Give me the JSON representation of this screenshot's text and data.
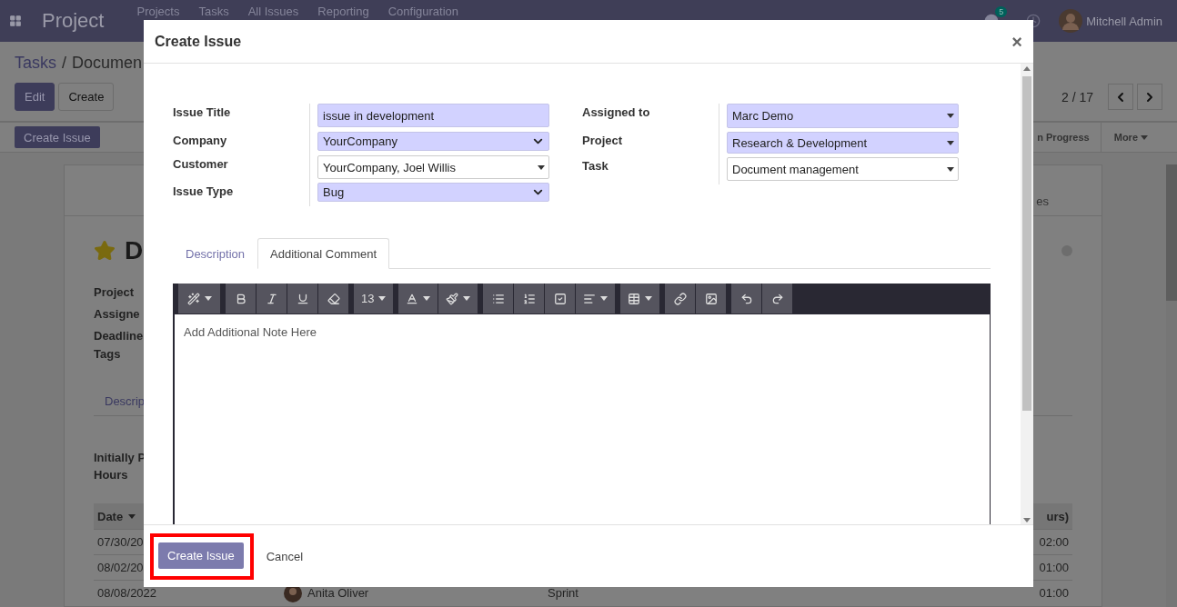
{
  "app_bar": {
    "app_name": "Project",
    "menu": [
      "Projects",
      "Tasks",
      "All Issues",
      "Reporting",
      "Configuration"
    ],
    "chat_badge": "5",
    "user_name": "Mitchell Admin"
  },
  "breadcrumb": {
    "parent": "Tasks",
    "separator": "/",
    "current": "Documen"
  },
  "control_buttons": [
    {
      "label": "Edit",
      "kind": "primary"
    },
    {
      "label": "Create",
      "kind": "secondary"
    }
  ],
  "pager": "2 / 17",
  "status_bar": {
    "button": "Create Issue",
    "stage": "n Progress",
    "more": "More"
  },
  "record": {
    "tab": "es",
    "starred": true,
    "title": "D",
    "field_labels": [
      "Project",
      "Assigne",
      "Deadline",
      "Tags"
    ],
    "notebook_tab": "Descrip",
    "hours_labels": [
      "Initially P",
      "Hours"
    ],
    "table": {
      "columns": [
        "Date",
        "urs)"
      ],
      "rows": [
        {
          "date": "07/30/20",
          "hours": "02:00"
        },
        {
          "date": "08/02/20",
          "hours": "01:00"
        },
        {
          "date": "08/08/2022",
          "employee": "Anita Oliver",
          "description": "Sprint",
          "hours": "01:00"
        }
      ]
    }
  },
  "dialog": {
    "title": "Create Issue",
    "close": "×",
    "form": {
      "left": [
        {
          "label": "Issue Title",
          "value": "issue in development",
          "kind": "input",
          "required": true
        },
        {
          "label": "Company",
          "value": "YourCompany",
          "kind": "select",
          "required": true
        },
        {
          "label": "Customer",
          "value": "YourCompany, Joel Willis",
          "kind": "many2one",
          "required": false
        },
        {
          "label": "Issue Type",
          "value": "Bug",
          "kind": "select",
          "required": true
        }
      ],
      "right": [
        {
          "label": "Assigned to",
          "value": "Marc Demo",
          "kind": "many2one",
          "required": true
        },
        {
          "label": "Project",
          "value": "Research & Development",
          "kind": "many2one",
          "required": true
        },
        {
          "label": "Task",
          "value": "Document management",
          "kind": "many2one",
          "required": false
        }
      ]
    },
    "tabs": [
      {
        "label": "Description",
        "selected": false
      },
      {
        "label": "Additional Comment",
        "selected": true
      }
    ],
    "font_size": "13",
    "editor_placeholder": "Add Additional Note Here",
    "buttons": [
      {
        "label": "Create Issue",
        "kind": "primary",
        "highlighted": true
      },
      {
        "label": "Cancel",
        "kind": "link",
        "highlighted": false
      }
    ]
  }
}
